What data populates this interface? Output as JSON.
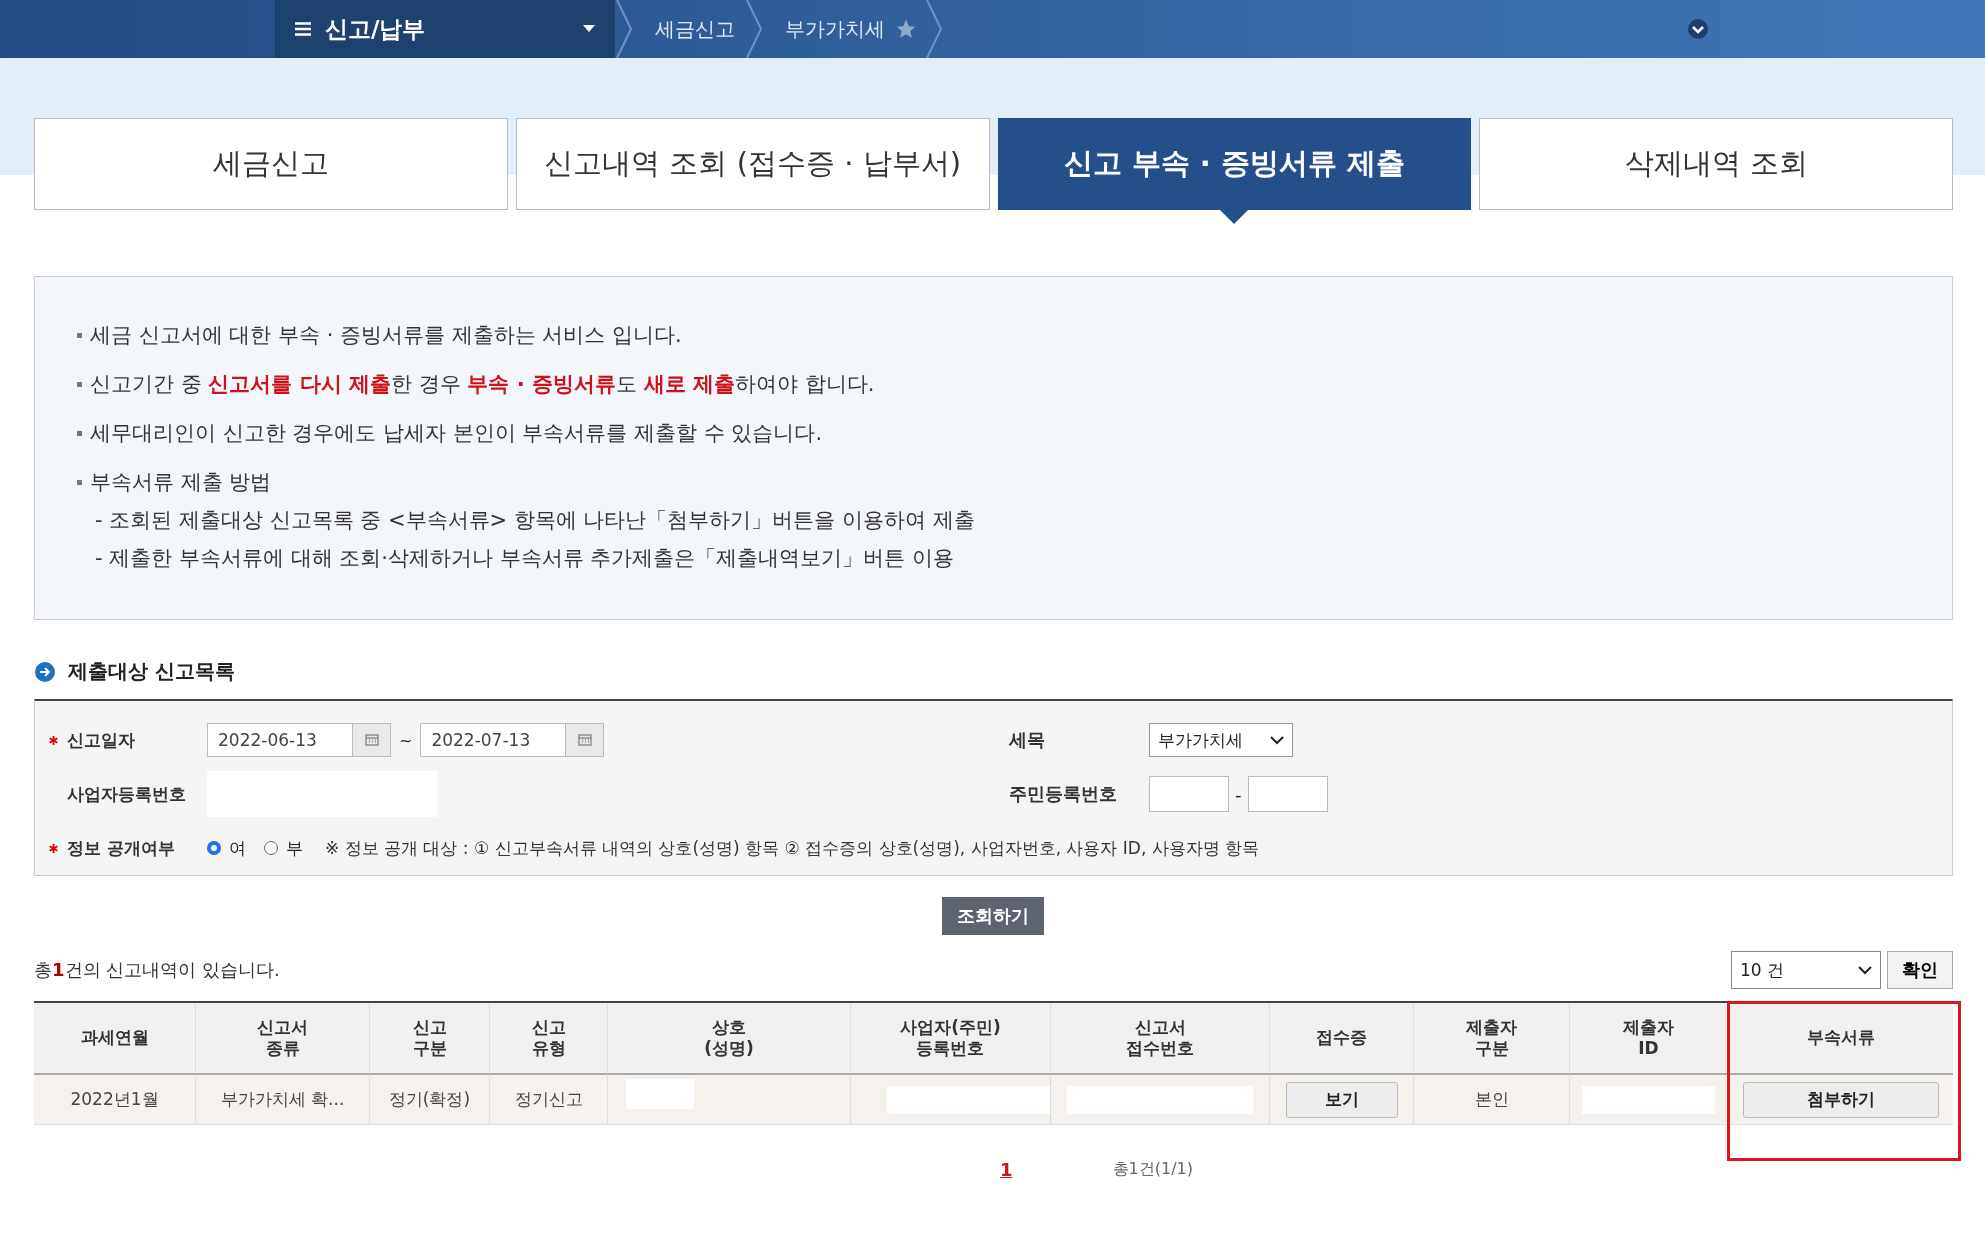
{
  "nav": {
    "menu": "신고/납부",
    "breadcrumbs": [
      "세금신고",
      "부가가치세"
    ]
  },
  "tabs": [
    {
      "label": "세금신고",
      "selected": false
    },
    {
      "label": "신고내역 조회 (접수증 · 납부서)",
      "selected": false
    },
    {
      "label": "신고 부속 · 증빙서류 제출",
      "selected": true
    },
    {
      "label": "삭제내역 조회",
      "selected": false
    }
  ],
  "notice": [
    {
      "text": "세금 신고서에 대한 부속 · 증빙서류를 제출하는 서비스 입니다."
    },
    {
      "text": "신고기간 중 **신고서를 다시 제출**한 경우 **부속 · 증빙서류**도 **새로 제출**하여야 합니다."
    },
    {
      "text": "세무대리인이 신고한 경우에도 납세자 본인이 부속서류를 제출할 수 있습니다."
    },
    {
      "text": "부속서류 제출 방법",
      "sub": [
        "- 조회된 제출대상 신고목록 중 <부속서류> 항목에 나타난「첨부하기」버튼을 이용하여 제출",
        "- 제출한 부속서류에 대해 조회·삭제하거나 부속서류 추가제출은「제출내역보기」버튼 이용"
      ]
    }
  ],
  "section_title": "제출대상 신고목록",
  "form": {
    "date": {
      "label": "신고일자",
      "required": true,
      "from": "2022-06-13",
      "to": "2022-07-13",
      "separator": "~"
    },
    "tax_item": {
      "label": "세목",
      "value": "부가가치세"
    },
    "business_no": {
      "label": "사업자등록번호"
    },
    "resident_no": {
      "label": "주민등록번호",
      "separator": "-"
    },
    "disclosure": {
      "label": "정보 공개여부",
      "required": true,
      "options": [
        {
          "label": "여",
          "selected": true
        },
        {
          "label": "부",
          "selected": false
        }
      ],
      "note": "※ 정보 공개 대상 : ① 신고부속서류 내역의 상호(성명) 항목 ② 접수증의 상호(성명), 사업자번호, 사용자 ID, 사용자명 항목"
    }
  },
  "search_button": "조회하기",
  "summary": "총**1**건의 신고내역이 있습니다.",
  "page_size": "10 건",
  "confirm_button": "확인",
  "table": {
    "columns": [
      "과세연월",
      "신고서\n종류",
      "신고\n구분",
      "신고\n유형",
      "상호\n(성명)",
      "사업자(주민)\n등록번호",
      "신고서\n접수번호",
      "접수증",
      "제출자\n구분",
      "제출자\nID",
      "부속서류"
    ],
    "rows": [
      {
        "cells": [
          {
            "kind": "text",
            "text": "2022년1월"
          },
          {
            "kind": "text",
            "text": "부가가치세 확..."
          },
          {
            "kind": "text",
            "text": "정기(확정)"
          },
          {
            "kind": "text",
            "text": "정기신고"
          },
          {
            "kind": "blank_short"
          },
          {
            "kind": "blank_left"
          },
          {
            "kind": "blank"
          },
          {
            "kind": "button",
            "text": "보기"
          },
          {
            "kind": "text",
            "text": "본인"
          },
          {
            "kind": "blank"
          },
          {
            "kind": "button",
            "text": "첨부하기"
          }
        ]
      }
    ]
  },
  "pagination": {
    "pages": [
      {
        "label": "1",
        "selected": true
      }
    ],
    "total": "총1건(1/1)"
  }
}
